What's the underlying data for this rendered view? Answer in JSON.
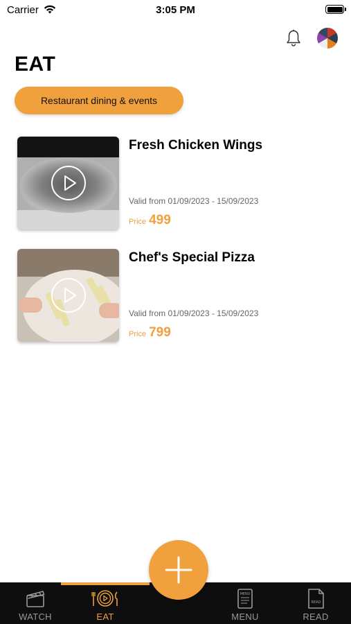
{
  "status_bar": {
    "carrier": "Carrier",
    "time": "3:05 PM"
  },
  "header": {
    "title": "EAT",
    "icons": [
      "bell-icon",
      "avatar"
    ]
  },
  "filter_chip": {
    "label": "Restaurant dining & events"
  },
  "items": [
    {
      "title": "Fresh Chicken Wings",
      "valid": "Valid from 01/09/2023 - 15/09/2023",
      "price_label": "Price",
      "price": "499",
      "thumbnail_icon": "play-icon"
    },
    {
      "title": "Chef's Special Pizza",
      "valid": "Valid from 01/09/2023 - 15/09/2023",
      "price_label": "Price",
      "price": "799",
      "thumbnail_icon": "play-icon"
    }
  ],
  "bottom_nav": {
    "items": [
      {
        "label": "WATCH",
        "icon": "clapperboard-icon",
        "active": false
      },
      {
        "label": "EAT",
        "icon": "plate-icon",
        "active": true
      },
      {
        "label": "MENU",
        "icon": "menu-icon",
        "active": false
      },
      {
        "label": "READ",
        "icon": "document-icon",
        "active": false
      }
    ],
    "fab_icon": "plus-icon"
  },
  "colors": {
    "accent": "#f0a03c",
    "nav_background": "#0e0e0e",
    "inactive_nav": "#9a9a9a"
  }
}
